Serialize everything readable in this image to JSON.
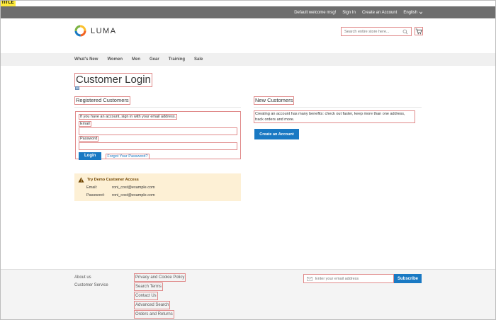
{
  "debug_title": "TITLE",
  "panel": {
    "welcome": "Default welcome msg!",
    "sign_in": "Sign In",
    "create_account": "Create an Account",
    "language": "English"
  },
  "brand": {
    "name": "LUMA"
  },
  "search": {
    "placeholder": "Search entire store here..."
  },
  "nav": {
    "items": [
      "What's New",
      "Women",
      "Men",
      "Gear",
      "Training",
      "Sale"
    ]
  },
  "page": {
    "title": "Customer Login"
  },
  "registered": {
    "title": "Registered Customers",
    "note": "If you have an account, sign in with your email address.",
    "email_label": "Email",
    "password_label": "Password",
    "login_button": "Login",
    "forgot_link": "Forgot Your Password?"
  },
  "new_customers": {
    "title": "New Customers",
    "text": "Creating an account has many benefits: check out faster, keep more than one address, track orders and more.",
    "button": "Create an Account"
  },
  "demo": {
    "title": "Try Demo Customer Access",
    "email_label": "Email:",
    "email_value": "roni_cost@example.com",
    "password_label": "Password:",
    "password_value": "roni_cost@example.com"
  },
  "footer": {
    "col1": [
      "About us",
      "Customer Service"
    ],
    "col2": [
      "Privacy and Cookie Policy",
      "Search Terms",
      "Contact Us",
      "Advanced Search",
      "Orders and Returns"
    ],
    "newsletter_placeholder": "Enter your email address",
    "subscribe": "Subscribe"
  },
  "colors": {
    "primary": "#1979c3",
    "panel": "#6e6e6e",
    "notice": "#fdf0d5"
  }
}
